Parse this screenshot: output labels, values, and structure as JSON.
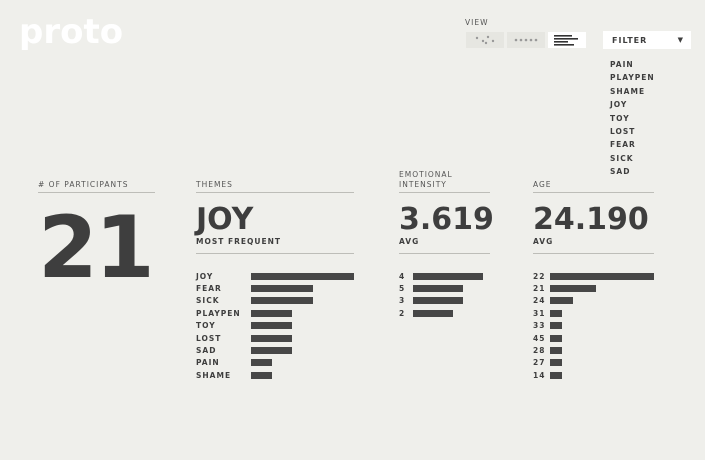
{
  "header": {
    "logo": "proto"
  },
  "view": {
    "label": "VIEW",
    "buttons": [
      {
        "name": "scatter-view",
        "icon": "dots-scatter-icon",
        "active": false
      },
      {
        "name": "dots-view",
        "icon": "dots-row-icon",
        "active": false
      },
      {
        "name": "bars-view",
        "icon": "bars-icon",
        "active": true
      }
    ]
  },
  "filter": {
    "label": "FILTER",
    "items": [
      "PAIN",
      "PLAYPEN",
      "SHAME",
      "JOY",
      "TOY",
      "LOST",
      "FEAR",
      "SICK",
      "SAD"
    ]
  },
  "participants": {
    "label": "# OF PARTICIPANTS",
    "value": "21"
  },
  "themes": {
    "label": "THEMES",
    "value": "JOY",
    "sub": "MOST FREQUENT",
    "bars": [
      {
        "label": "JOY",
        "value": 5
      },
      {
        "label": "FEAR",
        "value": 3
      },
      {
        "label": "SICK",
        "value": 3
      },
      {
        "label": "PLAYPEN",
        "value": 2
      },
      {
        "label": "TOY",
        "value": 2
      },
      {
        "label": "LOST",
        "value": 2
      },
      {
        "label": "SAD",
        "value": 2
      },
      {
        "label": "PAIN",
        "value": 1
      },
      {
        "label": "SHAME",
        "value": 1
      }
    ]
  },
  "intensity": {
    "label_line1": "EMOTIONAL",
    "label_line2": "INTENSITY",
    "value": "3.619",
    "sub": "AVG",
    "bars": [
      {
        "label": "4",
        "value": 7
      },
      {
        "label": "5",
        "value": 5
      },
      {
        "label": "3",
        "value": 5
      },
      {
        "label": "2",
        "value": 4
      }
    ]
  },
  "age": {
    "label": "AGE",
    "value": "24.190",
    "sub": "AVG",
    "bars": [
      {
        "label": "22",
        "value": 9
      },
      {
        "label": "21",
        "value": 4
      },
      {
        "label": "24",
        "value": 2
      },
      {
        "label": "31",
        "value": 1
      },
      {
        "label": "33",
        "value": 1
      },
      {
        "label": "45",
        "value": 1
      },
      {
        "label": "28",
        "value": 1
      },
      {
        "label": "27",
        "value": 1
      },
      {
        "label": "14",
        "value": 1
      }
    ]
  },
  "colors": {
    "background": "#efefeb",
    "bar": "#474747",
    "text": "#3e3e3e",
    "logo": "#ffffff"
  }
}
